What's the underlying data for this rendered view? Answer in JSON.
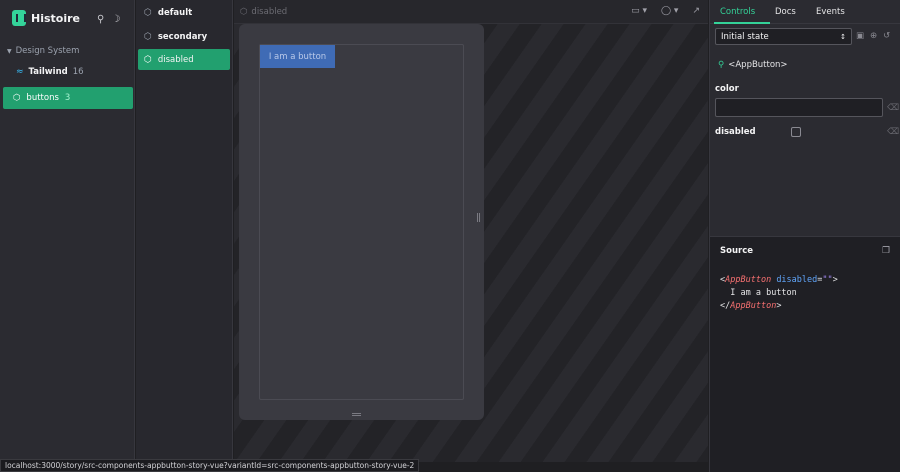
{
  "app": {
    "name": "Histoire"
  },
  "sidebar": {
    "group_label": "Design System",
    "items": [
      {
        "label": "Tailwind",
        "count": "16"
      },
      {
        "label": "buttons",
        "count": "3"
      }
    ]
  },
  "variants": [
    {
      "label": "default"
    },
    {
      "label": "secondary"
    },
    {
      "label": "disabled"
    }
  ],
  "preview": {
    "title": "disabled",
    "button_label": "I am a button"
  },
  "panel": {
    "tabs": [
      "Controls",
      "Docs",
      "Events"
    ],
    "state_select": "Initial state",
    "component_name": "<AppButton>",
    "controls": [
      {
        "label": "color",
        "value": ""
      },
      {
        "label": "disabled",
        "checked": false
      }
    ]
  },
  "source": {
    "title": "Source",
    "tag_open": "AppButton",
    "attr_name": "disabled",
    "attr_value": "\"\"",
    "inner_text": "I am a button",
    "tag_close": "AppButton"
  },
  "status_url": "localhost:3000/story/src-components-appbutton-story-vue?variantId=src-components-appbutton-story-vue-2",
  "colors": {
    "accent": "#22a06f",
    "demo_button": "#3f6bb5"
  }
}
